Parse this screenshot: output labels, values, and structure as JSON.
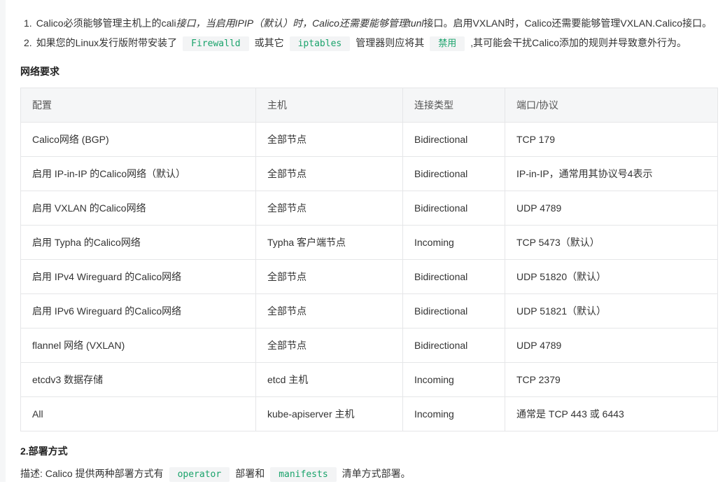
{
  "notes": {
    "item1": {
      "num": "1.",
      "t1": "Calico必须能够管理主机上的cali",
      "t2": "接口，当启用IPIP（默认）时，Calico还需要能够管理tunl",
      "t3": "接口。启用VXLAN时，Calico还需要能够管理VXLAN.Calico接口。"
    },
    "item2": {
      "num": "2.",
      "t1": "如果您的Linux发行版附带安装了",
      "code1": "Firewalld",
      "t2": "或其它",
      "code2": "iptables",
      "t3": "管理器则应将其",
      "code3": "禁用",
      "t4": ",其可能会干扰Calico添加的规则并导致意外行为。"
    }
  },
  "network_heading": "网络要求",
  "table": {
    "headers": [
      "配置",
      "主机",
      "连接类型",
      "端口/协议"
    ],
    "rows": [
      [
        "Calico网络 (BGP)",
        "全部节点",
        "Bidirectional",
        "TCP 179"
      ],
      [
        "启用 IP-in-IP 的Calico网络（默认）",
        "全部节点",
        "Bidirectional",
        "IP-in-IP，通常用其协议号4表示"
      ],
      [
        "启用 VXLAN 的Calico网络",
        "全部节点",
        "Bidirectional",
        "UDP 4789"
      ],
      [
        "启用 Typha 的Calico网络",
        "Typha 客户端节点",
        "Incoming",
        "TCP 5473（默认）"
      ],
      [
        "启用 IPv4 Wireguard 的Calico网络",
        "全部节点",
        "Bidirectional",
        "UDP 51820（默认）"
      ],
      [
        "启用 IPv6 Wireguard 的Calico网络",
        "全部节点",
        "Bidirectional",
        "UDP 51821（默认）"
      ],
      [
        "flannel 网络 (VXLAN)",
        "全部节点",
        "Bidirectional",
        "UDP 4789"
      ],
      [
        "etcdv3 数据存储",
        "etcd 主机",
        "Incoming",
        "TCP 2379"
      ],
      [
        "All",
        "kube-apiserver 主机",
        "Incoming",
        "通常是 TCP 443 或 6443"
      ]
    ]
  },
  "deploy_heading": "2.部署方式",
  "deploy_desc": {
    "t1": "描述: Calico 提供两种部署方式有",
    "code1": "operator",
    "t2": "部署和",
    "code2": "manifests",
    "t3": "清单方式部署。"
  }
}
